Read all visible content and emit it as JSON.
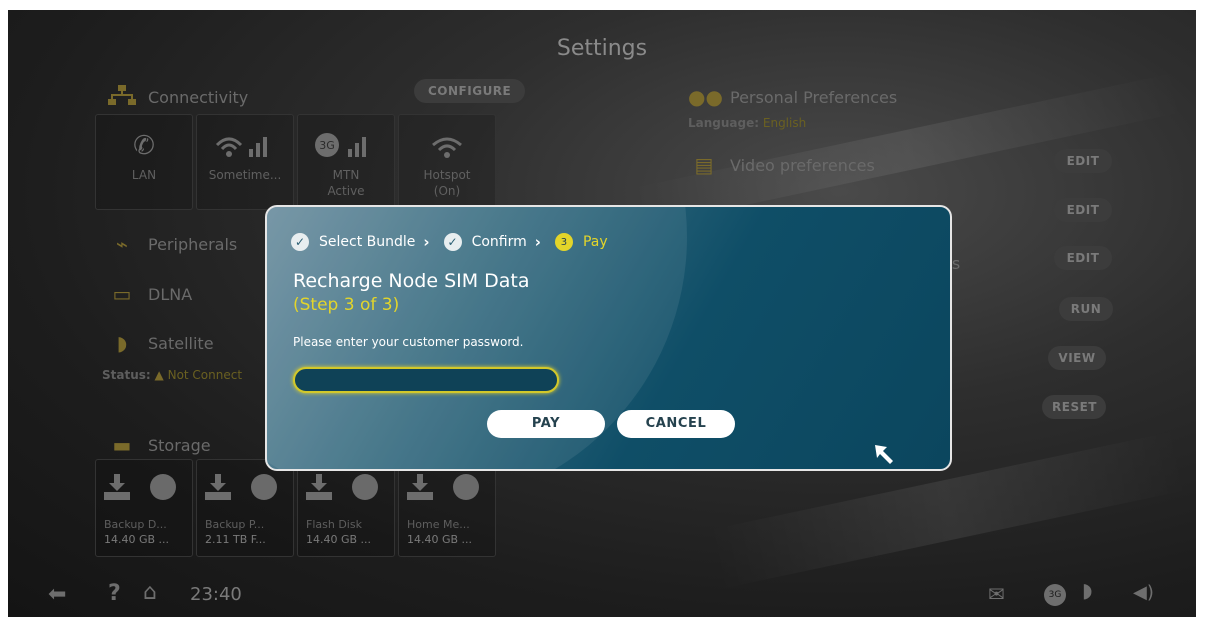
{
  "page_title": "Settings",
  "configure_label": "CONFIGURE",
  "left": {
    "connectivity": {
      "title": "Connectivity",
      "tiles": [
        {
          "label": "LAN",
          "sub": ""
        },
        {
          "label": "Sometime...",
          "sub": ""
        },
        {
          "label": "MTN",
          "sub": "Active"
        },
        {
          "label": "Hotspot",
          "sub": "(On)"
        }
      ]
    },
    "peripherals": "Peripherals",
    "dlna": "DLNA",
    "satellite": "Satellite",
    "satellite_status_label": "Status:",
    "satellite_status_value": "Not Connect",
    "storage": {
      "title": "Storage",
      "tiles": [
        {
          "name": "Backup D...",
          "size": "14.40 GB ..."
        },
        {
          "name": "Backup P...",
          "size": "2.11 TB F..."
        },
        {
          "name": "Flash Disk",
          "size": "14.40 GB ..."
        },
        {
          "name": "Home Me...",
          "size": "14.40 GB ..."
        }
      ]
    }
  },
  "right": {
    "personal_title": "Personal Preferences",
    "language_label": "Language:",
    "language_value": "English",
    "video_title": "Video preferences",
    "partial_text": "es",
    "buttons": [
      "EDIT",
      "EDIT",
      "EDIT",
      "RUN",
      "VIEW",
      "RESET"
    ]
  },
  "modal": {
    "steps": [
      "Select Bundle",
      "Confirm",
      "Pay"
    ],
    "step_number": "3",
    "title": "Recharge Node SIM Data",
    "step_text": "(Step 3 of 3)",
    "prompt": "Please enter your customer password.",
    "password_value": "",
    "pay_label": "PAY",
    "cancel_label": "CANCEL"
  },
  "bottom": {
    "time": "23:40",
    "help": "?",
    "badge_3g": "3G"
  },
  "colors": {
    "accent_yellow": "#e3d52a",
    "modal_bg": "#0f4e67"
  }
}
